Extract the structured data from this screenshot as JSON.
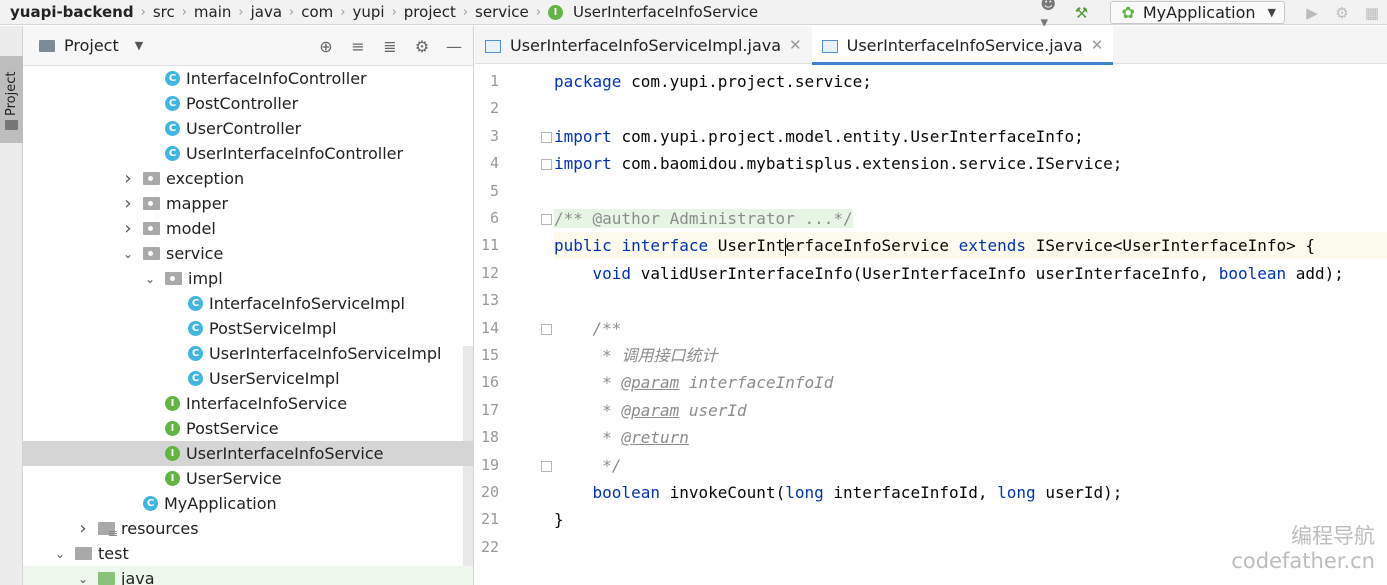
{
  "breadcrumb": {
    "items": [
      "yuapi-backend",
      "src",
      "main",
      "java",
      "com",
      "yupi",
      "project",
      "service"
    ],
    "current_badge": "I",
    "current": "UserInterfaceInfoService"
  },
  "toolbar": {
    "run_config": "MyApplication"
  },
  "left_strip": {
    "tab": "Project"
  },
  "project_panel": {
    "title": "Project"
  },
  "tree": [
    {
      "label": "InterfaceInfoController",
      "type": "class",
      "depth": 3,
      "expand": ""
    },
    {
      "label": "PostController",
      "type": "class",
      "depth": 3,
      "expand": ""
    },
    {
      "label": "UserController",
      "type": "class",
      "depth": 3,
      "expand": ""
    },
    {
      "label": "UserInterfaceInfoController",
      "type": "class",
      "depth": 3,
      "expand": ""
    },
    {
      "label": "exception",
      "type": "folder",
      "depth": 2,
      "expand": "collapsed"
    },
    {
      "label": "mapper",
      "type": "folder",
      "depth": 2,
      "expand": "collapsed"
    },
    {
      "label": "model",
      "type": "folder",
      "depth": 2,
      "expand": "collapsed"
    },
    {
      "label": "service",
      "type": "folder",
      "depth": 2,
      "expand": "expanded"
    },
    {
      "label": "impl",
      "type": "folder",
      "depth": 3,
      "expand": "expanded"
    },
    {
      "label": "InterfaceInfoServiceImpl",
      "type": "class",
      "depth": 4,
      "expand": ""
    },
    {
      "label": "PostServiceImpl",
      "type": "class",
      "depth": 4,
      "expand": ""
    },
    {
      "label": "UserInterfaceInfoServiceImpl",
      "type": "class",
      "depth": 4,
      "expand": ""
    },
    {
      "label": "UserServiceImpl",
      "type": "class",
      "depth": 4,
      "expand": ""
    },
    {
      "label": "InterfaceInfoService",
      "type": "interface",
      "depth": 3,
      "expand": ""
    },
    {
      "label": "PostService",
      "type": "interface",
      "depth": 3,
      "expand": ""
    },
    {
      "label": "UserInterfaceInfoService",
      "type": "interface",
      "depth": 3,
      "expand": "",
      "selected": true
    },
    {
      "label": "UserService",
      "type": "interface",
      "depth": 3,
      "expand": ""
    },
    {
      "label": "MyApplication",
      "type": "class",
      "depth": 2,
      "expand": ""
    },
    {
      "label": "resources",
      "type": "resfolder",
      "depth": 0,
      "expand": "collapsed"
    },
    {
      "label": "test",
      "type": "folder-plain",
      "depth": -1,
      "expand": "expanded"
    },
    {
      "label": "java",
      "type": "greenfolder",
      "depth": 0,
      "expand": "expanded",
      "green": true
    }
  ],
  "tabs": [
    {
      "label": "UserInterfaceInfoServiceImpl.java",
      "active": false
    },
    {
      "label": "UserInterfaceInfoService.java",
      "active": true
    }
  ],
  "code": [
    {
      "n": "1",
      "tokens": [
        [
          "kw",
          "package"
        ],
        [
          "",
          "com.yupi.project.service;"
        ]
      ]
    },
    {
      "n": "2",
      "tokens": []
    },
    {
      "n": "3",
      "tokens": [
        [
          "kw",
          "import"
        ],
        [
          "",
          "com.yupi.project.model.entity.UserInterfaceInfo;"
        ]
      ],
      "fold": true
    },
    {
      "n": "4",
      "tokens": [
        [
          "kw",
          "import"
        ],
        [
          "",
          "com.baomidou.mybatisplus.extension.service.IService;"
        ]
      ],
      "fold": true
    },
    {
      "n": "5",
      "tokens": []
    },
    {
      "n": "6",
      "tokens": [
        [
          "fold-cm",
          "/** @author Administrator ...*/"
        ]
      ],
      "fold": true
    },
    {
      "n": "11",
      "tokens": [
        [
          "kw",
          "public"
        ],
        [
          "kw",
          "interface"
        ],
        [
          "",
          "UserInt"
        ],
        [
          "caret",
          ""
        ],
        [
          "",
          "erfaceInfoService"
        ],
        [
          "kw",
          "extends"
        ],
        [
          "",
          "IService<UserInterfaceInfo> {"
        ]
      ],
      "current": true
    },
    {
      "n": "12",
      "tokens": [
        [
          "",
          "    "
        ],
        [
          "kw",
          "void"
        ],
        [
          "",
          "validUserInterfaceInfo(UserInterfaceInfo userInterfaceInfo,"
        ],
        [
          "kw",
          "boolean"
        ],
        [
          "",
          "add);"
        ]
      ]
    },
    {
      "n": "13",
      "tokens": []
    },
    {
      "n": "14",
      "tokens": [
        [
          "",
          "    "
        ],
        [
          "cm",
          "/**"
        ]
      ],
      "fold": true
    },
    {
      "n": "15",
      "tokens": [
        [
          "",
          "     "
        ],
        [
          "cm",
          "* 调用接口统计"
        ]
      ]
    },
    {
      "n": "16",
      "tokens": [
        [
          "",
          "     "
        ],
        [
          "cm",
          "*"
        ],
        [
          "tag",
          "@param"
        ],
        [
          "cm",
          "interfaceInfoId"
        ]
      ]
    },
    {
      "n": "17",
      "tokens": [
        [
          "",
          "     "
        ],
        [
          "cm",
          "*"
        ],
        [
          "tag",
          "@param"
        ],
        [
          "cm",
          "userId"
        ]
      ]
    },
    {
      "n": "18",
      "tokens": [
        [
          "",
          "     "
        ],
        [
          "cm",
          "*"
        ],
        [
          "tag",
          "@return"
        ]
      ]
    },
    {
      "n": "19",
      "tokens": [
        [
          "",
          "     "
        ],
        [
          "cm",
          "*/"
        ]
      ],
      "fold": true
    },
    {
      "n": "20",
      "tokens": [
        [
          "",
          "    "
        ],
        [
          "kw",
          "boolean"
        ],
        [
          "",
          "invokeCount("
        ],
        [
          "kw",
          "long"
        ],
        [
          "",
          "interfaceInfoId,"
        ],
        [
          "kw",
          "long"
        ],
        [
          "",
          "userId);"
        ]
      ]
    },
    {
      "n": "21",
      "tokens": [
        [
          "",
          "}"
        ]
      ]
    },
    {
      "n": "22",
      "tokens": []
    }
  ],
  "watermark": {
    "line1": "编程导航",
    "line2": "codefather.cn"
  }
}
